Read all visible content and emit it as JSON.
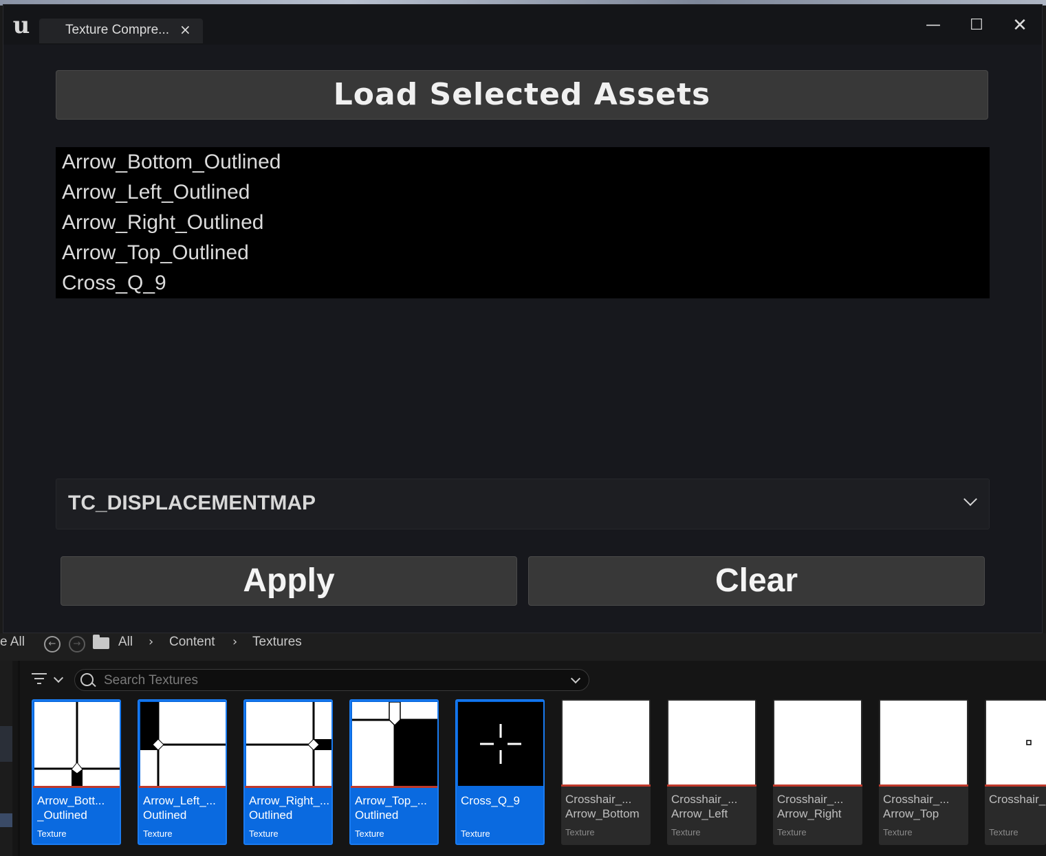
{
  "window": {
    "tab_title": "Texture Compre...",
    "tab_close": "×",
    "minimize": "—",
    "maximize": "☐",
    "close": "✕"
  },
  "utility": {
    "load_button": "Load Selected Assets",
    "assets": [
      "Arrow_Bottom_Outlined",
      "Arrow_Left_Outlined",
      "Arrow_Right_Outlined",
      "Arrow_Top_Outlined",
      "Cross_Q_9"
    ],
    "compression_setting": "TC_DISPLACEMENTMAP",
    "apply_button": "Apply",
    "clear_button": "Clear"
  },
  "content_browser": {
    "collapse_label": "e All",
    "breadcrumb": [
      "All",
      "Content",
      "Textures"
    ],
    "search_placeholder": "Search Textures",
    "tiles": [
      {
        "line1": "Arrow_Bott...",
        "line2": "_Outlined",
        "type": "Texture",
        "selected": true
      },
      {
        "line1": "Arrow_Left_...",
        "line2": "Outlined",
        "type": "Texture",
        "selected": true
      },
      {
        "line1": "Arrow_Right_...",
        "line2": "Outlined",
        "type": "Texture",
        "selected": true
      },
      {
        "line1": "Arrow_Top_...",
        "line2": "Outlined",
        "type": "Texture",
        "selected": true
      },
      {
        "line1": "Cross_Q_9",
        "line2": "",
        "type": "Texture",
        "selected": true
      },
      {
        "line1": "Crosshair_...",
        "line2": "Arrow_Bottom",
        "type": "Texture",
        "selected": false
      },
      {
        "line1": "Crosshair_...",
        "line2": "Arrow_Left",
        "type": "Texture",
        "selected": false
      },
      {
        "line1": "Crosshair_...",
        "line2": "Arrow_Right",
        "type": "Texture",
        "selected": false
      },
      {
        "line1": "Crosshair_...",
        "line2": "Arrow_Top",
        "type": "Texture",
        "selected": false
      },
      {
        "line1": "Crosshair_",
        "line2": "",
        "type": "Texture",
        "selected": false
      }
    ]
  },
  "colors": {
    "selected_tile": "#0a6ae0",
    "button_bg": "#383838",
    "list_bg": "#000000",
    "texture_underline": "#c0392b"
  }
}
